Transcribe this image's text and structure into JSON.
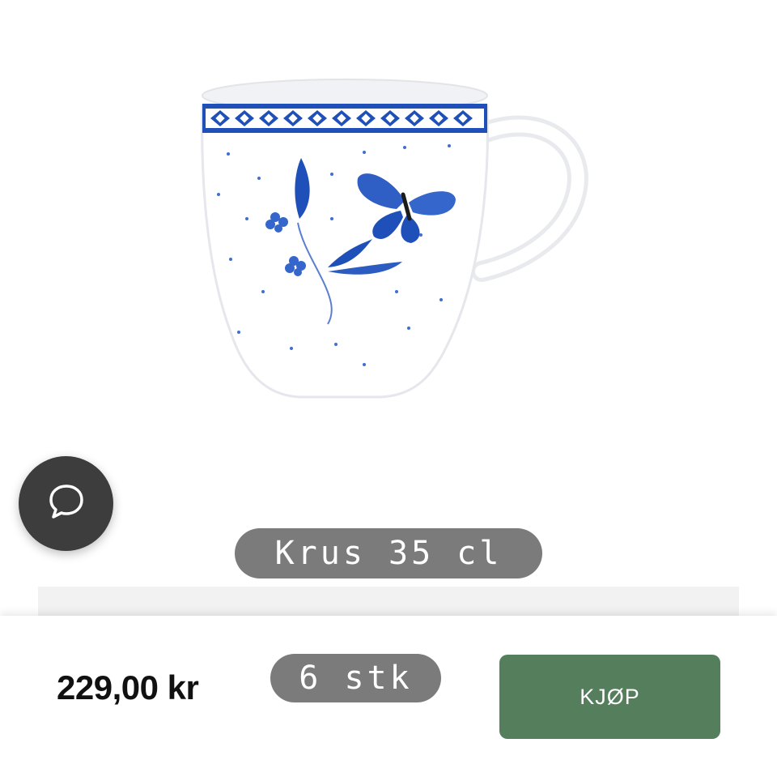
{
  "product": {
    "title": "Krus 35 cl",
    "image": "mug-blue-butterfly-floral"
  },
  "chat": {
    "icon": "chat-bubble-icon"
  },
  "purchase": {
    "price": "229,00 kr",
    "quantity": "6 stk",
    "buy_label": "KJØP"
  },
  "colors": {
    "pill_gray": "#7b7b7b",
    "chat_dark": "#3d3d3d",
    "buy_green": "#557e5c",
    "pattern_blue": "#1f4fb8"
  }
}
